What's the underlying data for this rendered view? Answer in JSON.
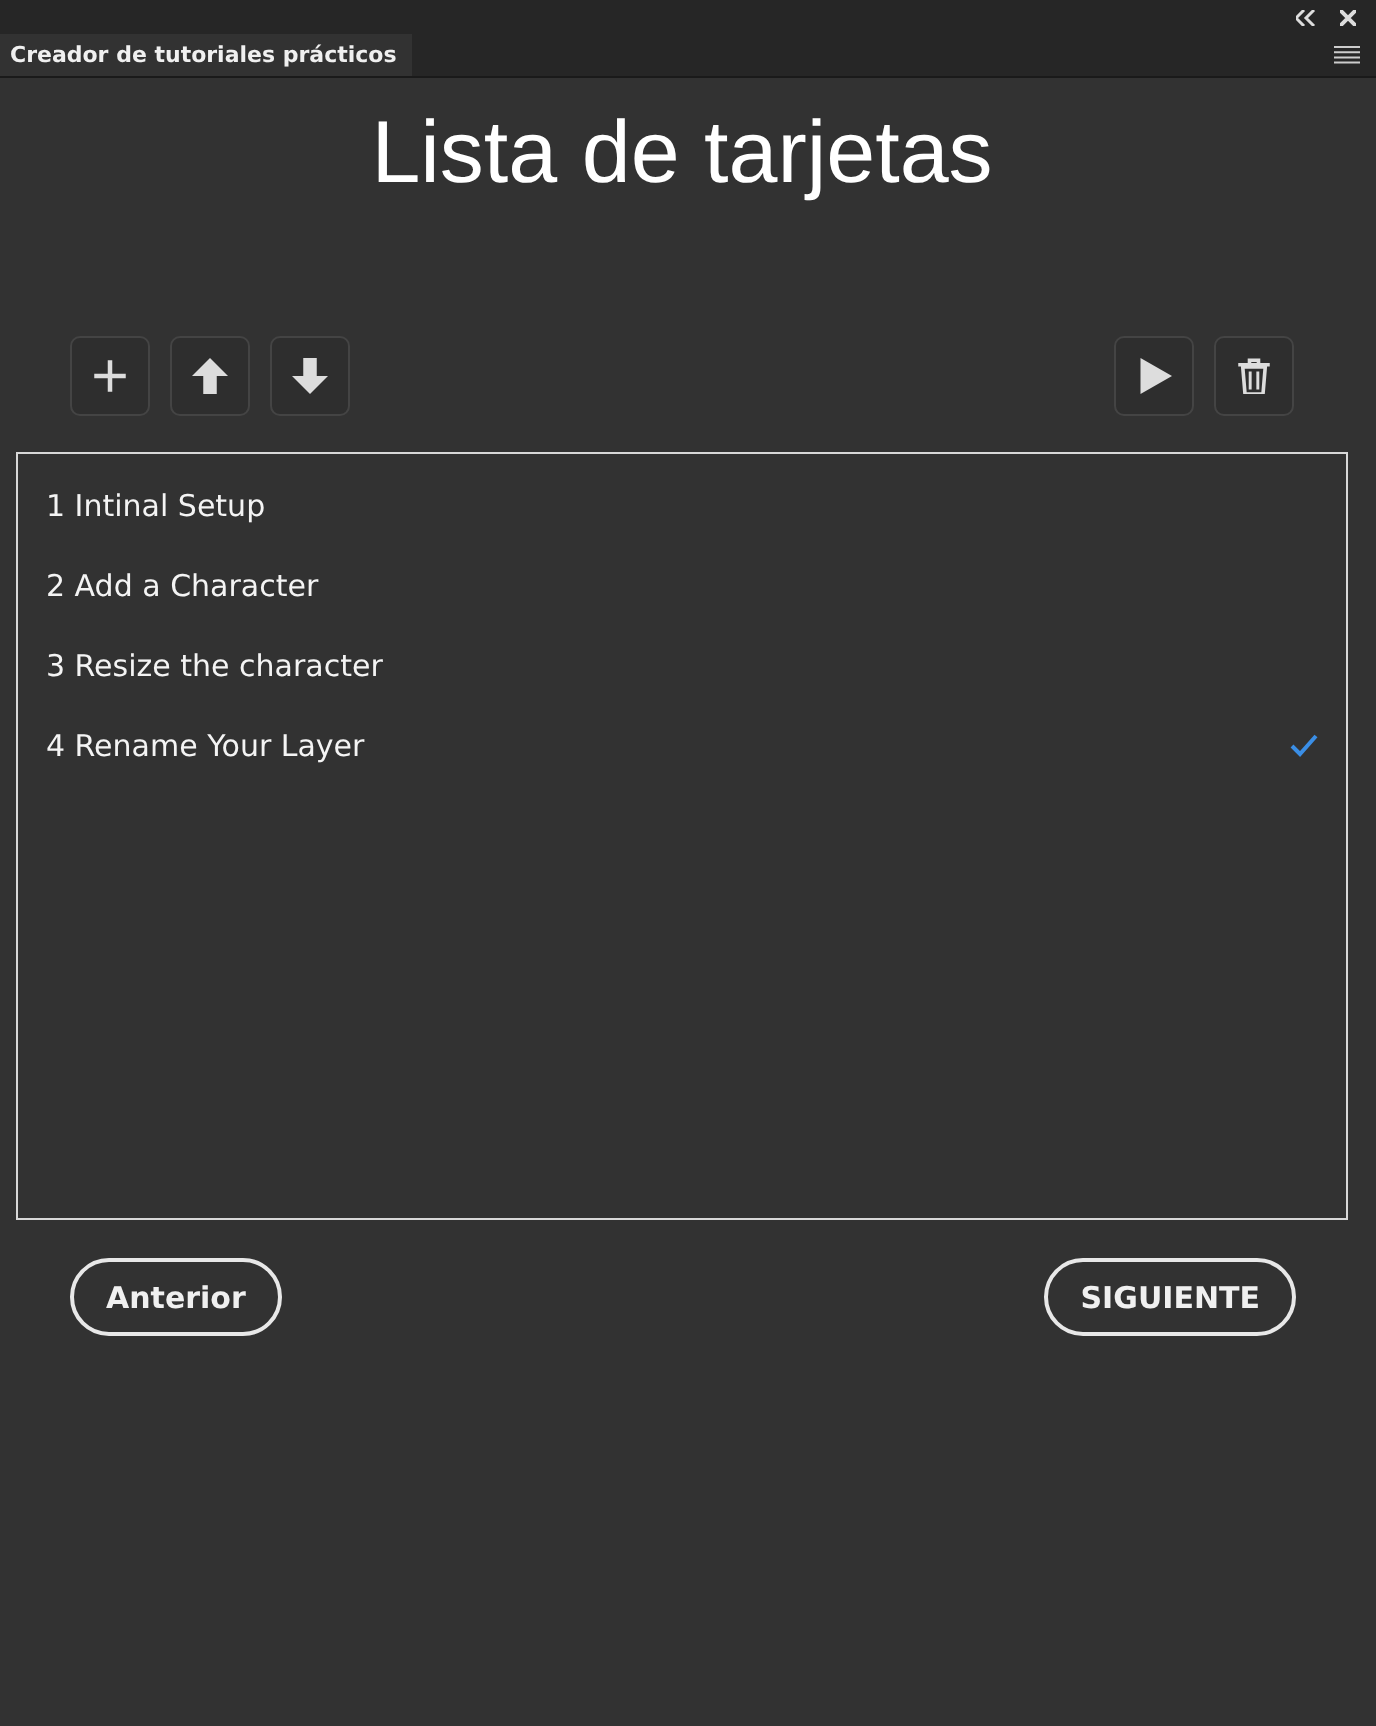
{
  "panel": {
    "tab": "Creador de tutoriales prácticos"
  },
  "title": "Lista de tarjetas",
  "toolbar": {
    "left": [
      {
        "kind": "add"
      },
      {
        "kind": "up"
      },
      {
        "kind": "down"
      }
    ],
    "right": [
      {
        "kind": "play"
      },
      {
        "kind": "delete"
      }
    ]
  },
  "cards": [
    {
      "label": "1 Intinal Setup",
      "checked": false
    },
    {
      "label": "2 Add a Character",
      "checked": false
    },
    {
      "label": "3 Resize the character",
      "checked": false
    },
    {
      "label": "4 Rename Your Layer",
      "checked": true
    }
  ],
  "buttons": {
    "previous": "Anterior",
    "next": "SIGUIENTE"
  }
}
